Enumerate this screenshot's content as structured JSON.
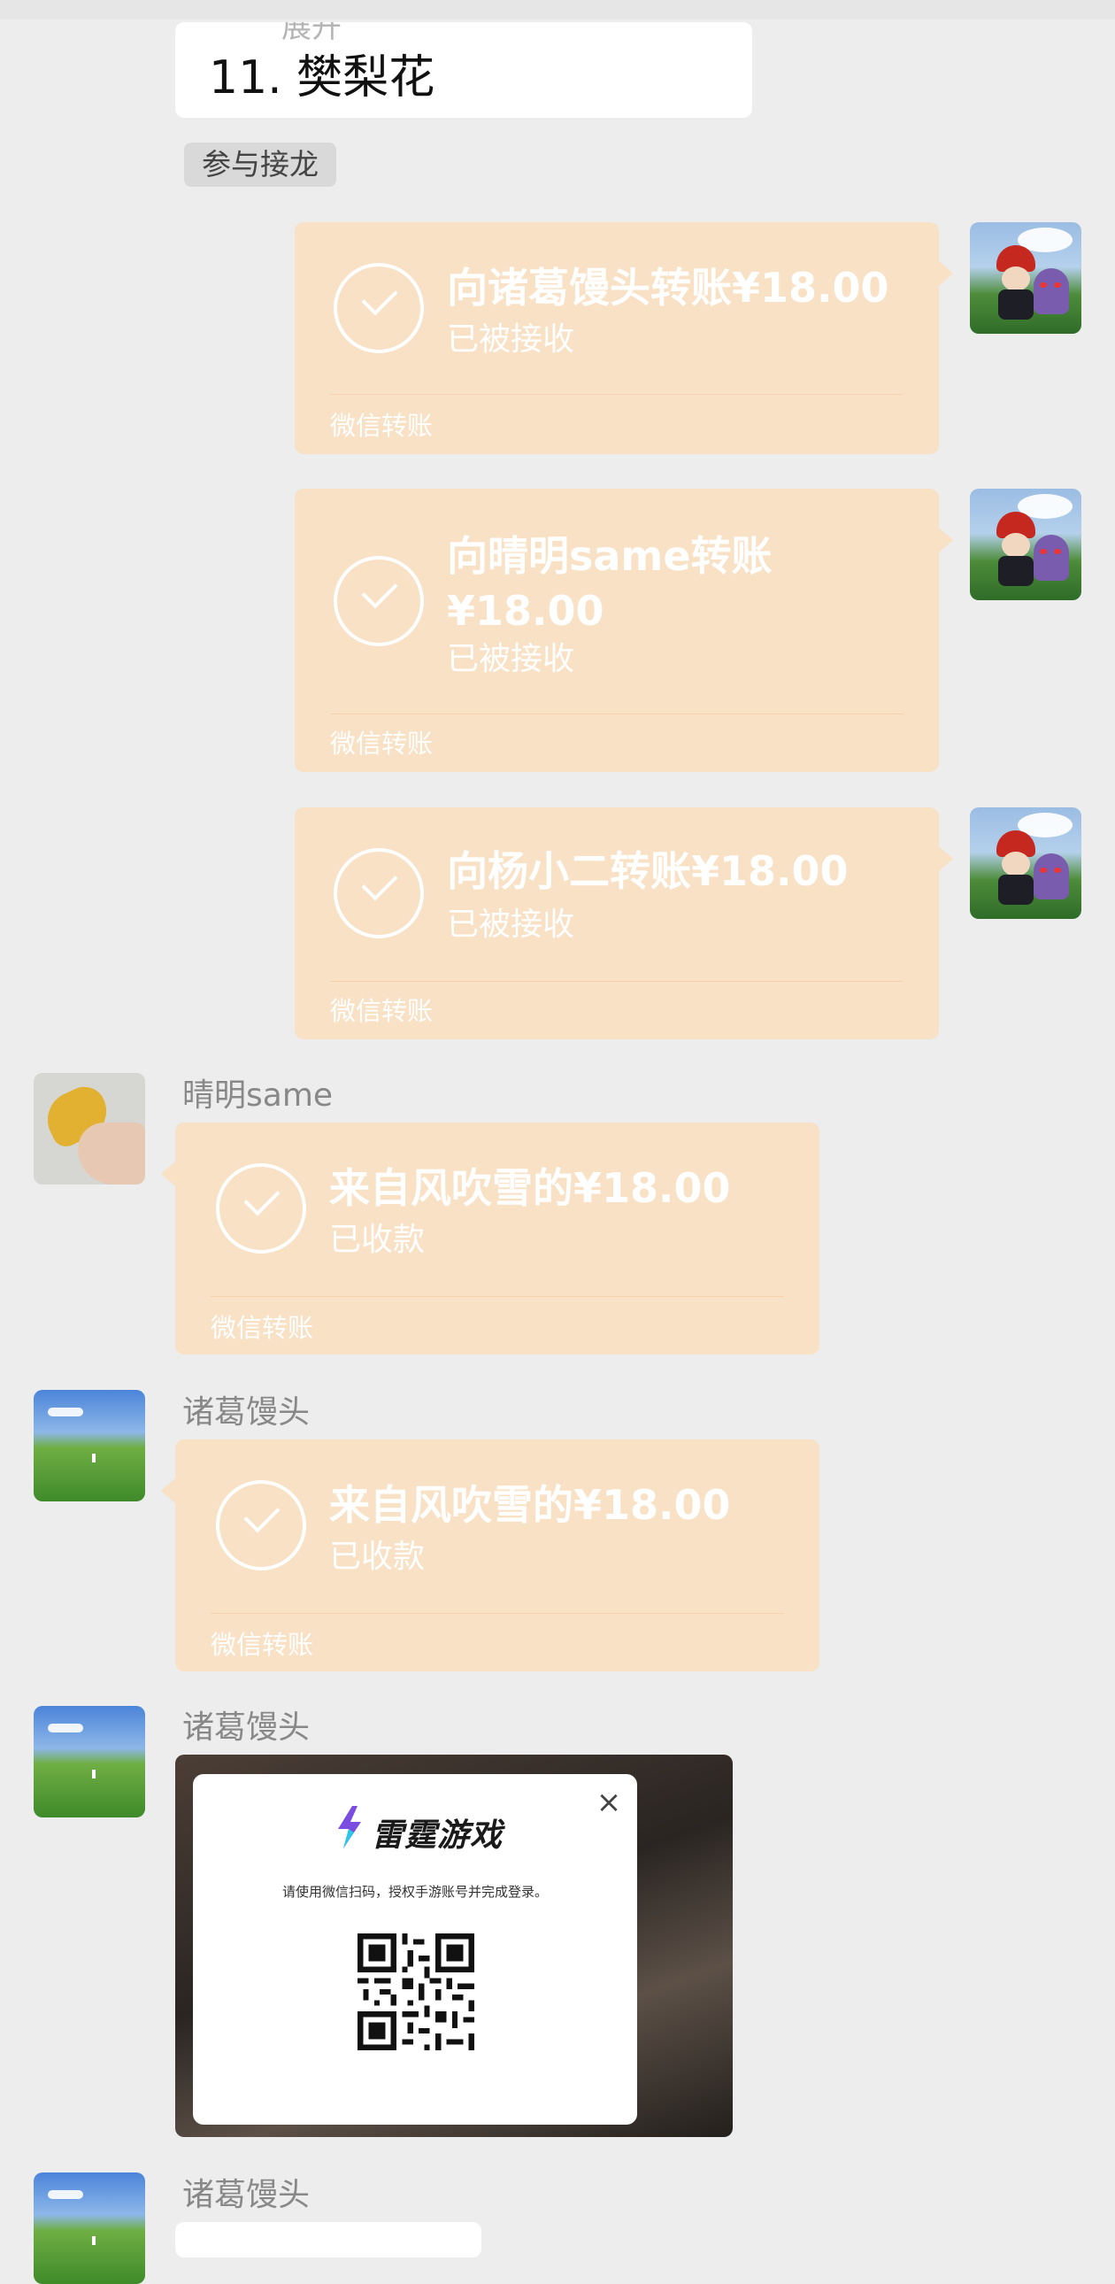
{
  "top_message": {
    "cut_line": "展开",
    "item": "11. 樊梨花"
  },
  "join_button": "参与接龙",
  "outgoing_transfers": [
    {
      "title_line1": "向诸葛馒头转账¥18.00",
      "title_line2": "",
      "status": "已被接收",
      "footer": "微信转账"
    },
    {
      "title_line1": "向晴明same转账",
      "title_line2": "¥18.00",
      "status": "已被接收",
      "footer": "微信转账"
    },
    {
      "title_line1": "向杨小二转账¥18.00",
      "title_line2": "",
      "status": "已被接收",
      "footer": "微信转账"
    }
  ],
  "incoming": [
    {
      "sender": "晴明same",
      "title": "来自风吹雪的¥18.00",
      "status": "已收款",
      "footer": "微信转账"
    },
    {
      "sender": "诸葛馒头",
      "title": "来自风吹雪的¥18.00",
      "status": "已收款",
      "footer": "微信转账"
    }
  ],
  "image_message": {
    "sender": "诸葛馒头",
    "brand": "雷霆游戏",
    "instruction": "请使用微信扫码，授权手游账号并完成登录。",
    "close_symbol": "×"
  },
  "last_message": {
    "sender": "诸葛馒头"
  },
  "colors": {
    "background": "#ededed",
    "transfer_bubble": "#f9e1c6",
    "text_bubble": "#ffffff"
  },
  "icons": [
    "check-circle-icon",
    "close-icon",
    "lightning-logo-icon",
    "qr-code"
  ]
}
